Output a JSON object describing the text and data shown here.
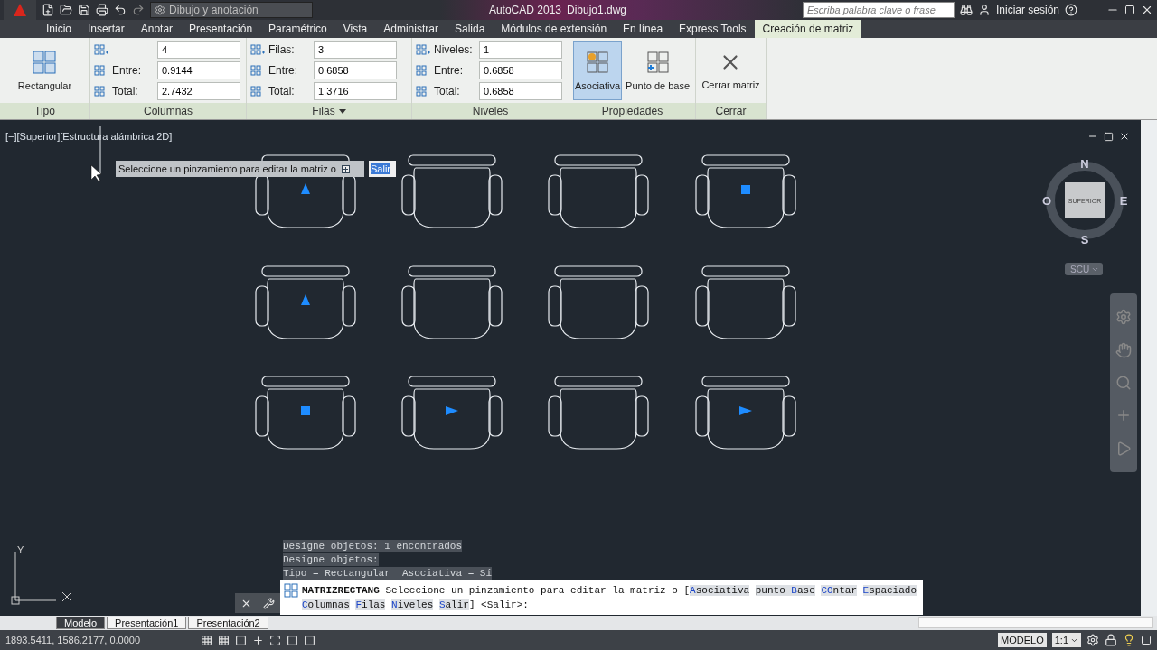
{
  "title_bar": {
    "workspace": "Dibujo y anotación",
    "title": "AutoCAD 2013",
    "file": "Dibujo1.dwg",
    "search_placeholder": "Escriba palabra clave o frase",
    "user": "Iniciar sesión"
  },
  "ribbon_tabs": [
    {
      "label": "Inicio",
      "selected": false
    },
    {
      "label": "Insertar",
      "selected": false
    },
    {
      "label": "Anotar",
      "selected": false
    },
    {
      "label": "Presentación",
      "selected": false
    },
    {
      "label": "Paramétrico",
      "selected": false
    },
    {
      "label": "Vista",
      "selected": false
    },
    {
      "label": "Administrar",
      "selected": false
    },
    {
      "label": "Salida",
      "selected": false
    },
    {
      "label": "Módulos de extensión",
      "selected": false
    },
    {
      "label": "En línea",
      "selected": false
    },
    {
      "label": "Express Tools",
      "selected": false
    },
    {
      "label": "Creación de matriz",
      "selected": true
    }
  ],
  "type_panel": {
    "button": "Rectangular",
    "title": "Tipo"
  },
  "field_panels": [
    {
      "title": "Columnas",
      "expandable": false,
      "fields": [
        {
          "value": "4"
        },
        {
          "label": "Entre:",
          "value": "0.9144"
        },
        {
          "label": "Total:",
          "value": "2.7432"
        }
      ]
    },
    {
      "title": "Filas",
      "expandable": true,
      "fields": [
        {
          "label": "Filas:",
          "value": "3"
        },
        {
          "label": "Entre:",
          "value": "0.6858"
        },
        {
          "label": "Total:",
          "value": "1.3716"
        }
      ]
    },
    {
      "title": "Niveles",
      "expandable": false,
      "fields": [
        {
          "label": "Niveles:",
          "value": "1"
        },
        {
          "label": "Entre:",
          "value": "0.6858"
        },
        {
          "label": "Total:",
          "value": "0.6858"
        }
      ]
    }
  ],
  "properties_panel": {
    "title": "Propiedades",
    "buttons": [
      {
        "label": "Asociativa",
        "selected": true
      },
      {
        "label": "Punto de base",
        "selected": false
      }
    ]
  },
  "close_panel": {
    "title": "Cerrar",
    "button": "Cerrar matriz"
  },
  "viewport_label": "[−][Superior][Estructura alámbrica 2D]",
  "tooltip": {
    "text": "Seleccione un pinzamiento para editar la matriz o",
    "option": "Salir"
  },
  "viewcube": {
    "north": "N",
    "south": "S",
    "east": "E",
    "west": "O",
    "face": "SUPERIOR",
    "ucs": "SCU"
  },
  "ucs_axis": "Y",
  "chairs": [
    {
      "kind": "up"
    },
    {
      "kind": "plain"
    },
    {
      "kind": "plain"
    },
    {
      "kind": "square"
    },
    {
      "kind": "up"
    },
    {
      "kind": "plain"
    },
    {
      "kind": "plain"
    },
    {
      "kind": "plain"
    },
    {
      "kind": "square"
    },
    {
      "kind": "right"
    },
    {
      "kind": "plain"
    },
    {
      "kind": "right"
    }
  ],
  "command_history": [
    "Designe objetos: 1 encontrados",
    "Designe objetos:",
    "Tipo = Rectangular  Asociativa = Sí"
  ],
  "command_line": {
    "command": "MATRIZRECTANG",
    "prompt": "Seleccione un pinzamiento para editar la matriz o [",
    "options": [
      {
        "key": "A",
        "after": "sociativa"
      },
      {
        "before": "punto ",
        "key": "B",
        "after": "ase"
      },
      {
        "key": "CO",
        "after": "ntar"
      },
      {
        "key": "E",
        "after": "spaciado"
      },
      {
        "key": "C",
        "after": "olumnas"
      },
      {
        "key": "F",
        "after": "ilas"
      },
      {
        "key": "N",
        "after": "iveles"
      },
      {
        "key": "S",
        "after": "alir"
      }
    ],
    "end": "] <Salir>:"
  },
  "layout_tabs": [
    {
      "label": "Modelo",
      "selected": true
    },
    {
      "label": "Presentación1",
      "selected": false
    },
    {
      "label": "Presentación2",
      "selected": false
    }
  ],
  "status_bar": {
    "coordinates": "1893.5411, 1586.2177, 0.0000",
    "space": "MODELO",
    "scale": "1:1"
  }
}
